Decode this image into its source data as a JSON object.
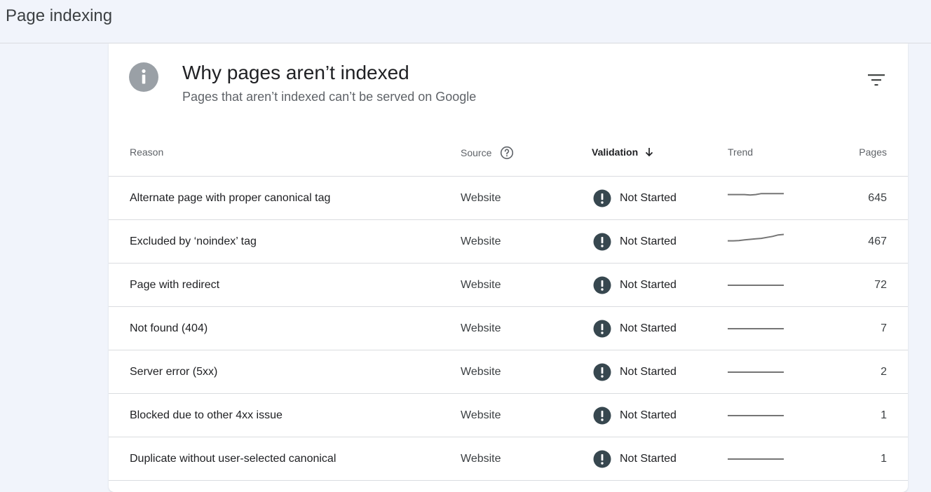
{
  "page": {
    "title": "Page indexing"
  },
  "card": {
    "title": "Why pages aren’t indexed",
    "subtitle": "Pages that aren’t indexed can’t be served on Google"
  },
  "table": {
    "headers": {
      "reason": "Reason",
      "source": "Source",
      "validation": "Validation",
      "trend": "Trend",
      "pages": "Pages"
    },
    "rows": [
      {
        "reason": "Alternate page with proper canonical tag",
        "source": "Website",
        "validation": "Not Started",
        "trend": [
          0.6,
          0.6,
          0.6,
          0.6,
          0.55,
          0.6,
          0.7,
          0.7,
          0.7,
          0.7,
          0.7
        ],
        "pages": "645"
      },
      {
        "reason": "Excluded by ‘noindex’ tag",
        "source": "Website",
        "validation": "Not Started",
        "trend": [
          0.1,
          0.1,
          0.12,
          0.2,
          0.25,
          0.3,
          0.35,
          0.45,
          0.55,
          0.7,
          0.75
        ],
        "pages": "467"
      },
      {
        "reason": "Page with redirect",
        "source": "Website",
        "validation": "Not Started",
        "trend": [
          0.0,
          0.0,
          0.0,
          0.0,
          0.0,
          0.0,
          0.0,
          0.0,
          0.0,
          0.0,
          0.0
        ],
        "pages": "72"
      },
      {
        "reason": "Not found (404)",
        "source": "Website",
        "validation": "Not Started",
        "trend": [
          0.0,
          0.0,
          0.0,
          0.0,
          0.0,
          0.0,
          0.0,
          0.0,
          0.0,
          0.0,
          0.0
        ],
        "pages": "7"
      },
      {
        "reason": "Server error (5xx)",
        "source": "Website",
        "validation": "Not Started",
        "trend": [
          0.0,
          0.0,
          0.0,
          0.0,
          0.0,
          0.0,
          0.0,
          0.0,
          0.0,
          0.0,
          0.0
        ],
        "pages": "2"
      },
      {
        "reason": "Blocked due to other 4xx issue",
        "source": "Website",
        "validation": "Not Started",
        "trend": [
          0.0,
          0.0,
          0.0,
          0.0,
          0.0,
          0.0,
          0.0,
          0.0,
          0.0,
          0.0,
          0.0
        ],
        "pages": "1"
      },
      {
        "reason": "Duplicate without user-selected canonical",
        "source": "Website",
        "validation": "Not Started",
        "trend": [
          0.0,
          0.0,
          0.0,
          0.0,
          0.0,
          0.0,
          0.0,
          0.0,
          0.0,
          0.0,
          0.0
        ],
        "pages": "1"
      }
    ]
  },
  "icons": {
    "info": "info-icon",
    "filter": "filter-icon",
    "help": "help-circle-icon",
    "sort": "arrow-down-icon",
    "status": "exclamation-circle-icon"
  },
  "colors": {
    "background": "#f1f4fb",
    "status_icon": "#37474f",
    "trend_line": "#757575",
    "info_icon": "#9aa0a6"
  }
}
